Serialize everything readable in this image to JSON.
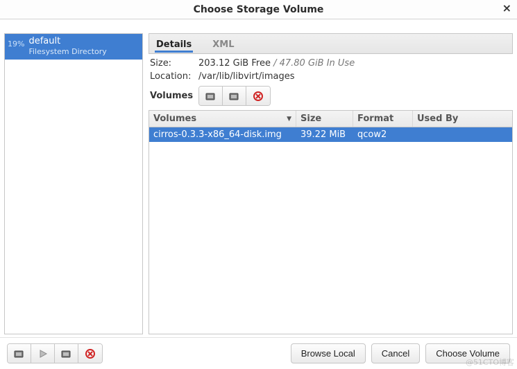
{
  "window": {
    "title": "Choose Storage Volume"
  },
  "pools": [
    {
      "name": "default",
      "type": "Filesystem Directory",
      "usage_pct": "19%"
    }
  ],
  "tabs": {
    "details": "Details",
    "xml": "XML"
  },
  "details": {
    "size_label": "Size:",
    "size_free": "203.12 GiB Free",
    "size_sep": " / ",
    "size_used": "47.80 GiB In Use",
    "location_label": "Location:",
    "location_value": "/var/lib/libvirt/images",
    "volumes_label": "Volumes"
  },
  "columns": {
    "name": "Volumes",
    "size": "Size",
    "format": "Format",
    "used_by": "Used By"
  },
  "volumes": [
    {
      "name": "cirros-0.3.3-x86_64-disk.img",
      "size": "39.22 MiB",
      "format": "qcow2",
      "used_by": ""
    }
  ],
  "buttons": {
    "browse_local": "Browse Local",
    "cancel": "Cancel",
    "choose_volume": "Choose Volume"
  },
  "watermark": "@51CTO博客"
}
